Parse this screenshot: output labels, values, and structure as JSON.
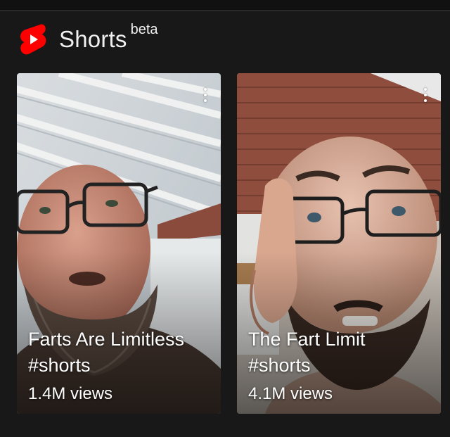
{
  "shelf": {
    "title": "Shorts",
    "badge": "beta",
    "logo_icon": "youtube-shorts-icon",
    "accent_color": "#ff0000"
  },
  "videos": [
    {
      "title": "Farts Are Limitless #shorts",
      "views": "1.4M views",
      "menu_icon": "more-vert-icon"
    },
    {
      "title": "The Fart Limit #shorts",
      "views": "4.1M views",
      "menu_icon": "more-vert-icon"
    }
  ]
}
